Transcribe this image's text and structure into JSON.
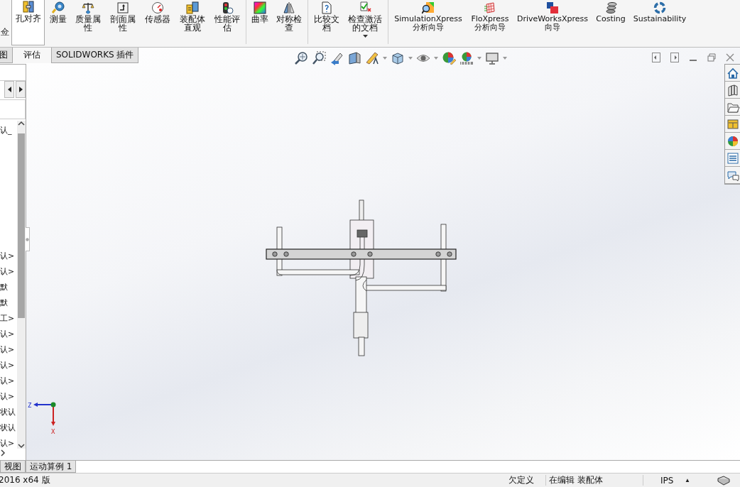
{
  "ribbon": {
    "groups": [
      {
        "items": [
          {
            "label": "佥",
            "selected": false,
            "has_menu": false
          },
          {
            "label": "孔对齐",
            "selected": true,
            "has_menu": false
          },
          {
            "label": "测量",
            "selected": false,
            "has_menu": false
          },
          {
            "label": "质量属性",
            "selected": false,
            "has_menu": false
          },
          {
            "label": "剖面属性",
            "selected": false,
            "has_menu": false
          },
          {
            "label": "传感器",
            "selected": false,
            "has_menu": false
          },
          {
            "label": "装配体直观",
            "selected": false,
            "has_menu": false
          },
          {
            "label": "性能评估",
            "selected": false,
            "has_menu": false
          }
        ]
      },
      {
        "items": [
          {
            "label": "曲率",
            "selected": false,
            "has_menu": false
          },
          {
            "label": "对称检查",
            "selected": false,
            "has_menu": false
          }
        ]
      },
      {
        "items": [
          {
            "label": "比较文档",
            "selected": false,
            "has_menu": false
          },
          {
            "label": "检查激活的文档",
            "selected": false,
            "has_menu": true
          }
        ]
      },
      {
        "items": [
          {
            "label": "SimulationXpress分析向导",
            "selected": false,
            "has_menu": false
          },
          {
            "label": "FloXpress分析向导",
            "selected": false,
            "has_menu": false
          },
          {
            "label": "DriveWorksXpress向导",
            "selected": false,
            "has_menu": false
          },
          {
            "label": "Costing",
            "selected": false,
            "has_menu": false
          },
          {
            "label": "Sustainability",
            "selected": false,
            "has_menu": false
          }
        ]
      }
    ]
  },
  "tabs": [
    {
      "label": "图",
      "selected": false
    },
    {
      "label": "评估",
      "selected": true
    },
    {
      "label": "SOLIDWORKS 插件",
      "selected": false
    }
  ],
  "feature_tree": {
    "items": [
      "认_",
      "认>",
      "认>",
      "默",
      "默",
      "工>",
      "认>",
      "认>",
      "认>",
      "认>",
      "认>",
      "状认",
      "状认",
      "认>"
    ]
  },
  "triad": {
    "horizontal_label": "Z",
    "vertical_label": "X"
  },
  "bottom_tabs": [
    {
      "label": "视图"
    },
    {
      "label": "运动算例 1"
    }
  ],
  "status_bar": {
    "version": "2016 x64 版",
    "status": "欠定义",
    "mode": "在编辑 装配体",
    "units": "IPS",
    "units_menu": "▲"
  }
}
